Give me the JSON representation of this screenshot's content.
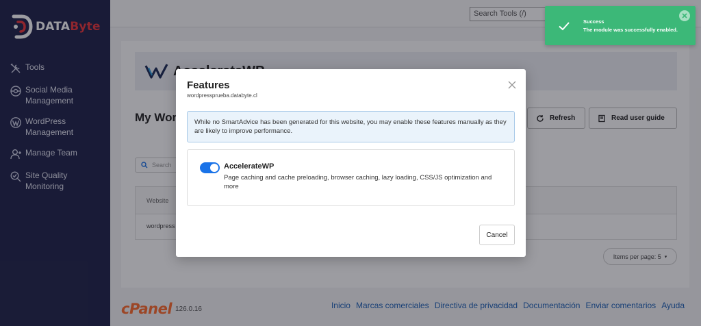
{
  "sidebar": {
    "brand_left": "DATA",
    "brand_right": "Byte",
    "items": [
      {
        "label": "Tools",
        "icon": "tools-icon"
      },
      {
        "label": "Social Media Management",
        "icon": "social-media-icon"
      },
      {
        "label": "WordPress Management",
        "icon": "wordpress-icon"
      },
      {
        "label": "Manage Team",
        "icon": "manage-team-icon"
      },
      {
        "label": "Site Quality Monitoring",
        "icon": "site-quality-icon"
      }
    ]
  },
  "topbar": {
    "search_placeholder": "Search Tools (/)"
  },
  "page": {
    "header_title": "AccelerateWP",
    "title": "My Wor",
    "refresh_label": "Refresh",
    "guide_label": "Read user guide",
    "search_placeholder": "Search",
    "table_header": "Website",
    "table_row": "wordpress",
    "pager_label": "Items per page: 5"
  },
  "footer": {
    "logo": "cPanel",
    "version": "126.0.16",
    "links": [
      "Inicio",
      "Marcas comerciales",
      "Directiva de privacidad",
      "Documentación",
      "Enviar comentarios",
      "Ayuda"
    ]
  },
  "modal": {
    "title": "Features",
    "subtitle": "wordpressprueba.databyte.cl",
    "info": "While no SmartAdvice has been generated for this website, you may enable these features manually as they are likely to improve performance.",
    "feature": {
      "name": "AccelerateWP",
      "description": "Page caching and cache preloading, browser caching, lazy loading, CSS/JS optimization and more",
      "enabled": true
    },
    "cancel_label": "Cancel"
  },
  "toast": {
    "title": "Success",
    "message": "The module was successfully enabled."
  },
  "colors": {
    "sidebar": "#1e2149",
    "toast": "#3cb878",
    "toggle": "#1a73e8",
    "cpanel": "#ff6c2c",
    "link": "#1b5fb5"
  }
}
